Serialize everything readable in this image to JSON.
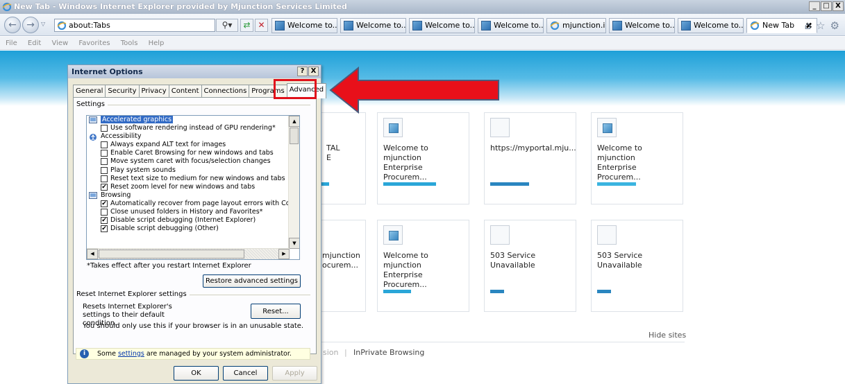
{
  "window": {
    "title": "New Tab - Windows Internet Explorer provided by Mjunction Services Limited",
    "controls": [
      "_",
      "□",
      "X"
    ]
  },
  "nav": {
    "address": "about:Tabs",
    "tabs": [
      {
        "label": "Welcome to..."
      },
      {
        "label": "Welcome to..."
      },
      {
        "label": "Welcome to..."
      },
      {
        "label": "Welcome to..."
      },
      {
        "label": "mjunction.in"
      },
      {
        "label": "Welcome to..."
      },
      {
        "label": "Welcome to..."
      },
      {
        "label": "New Tab"
      }
    ],
    "close_tab": "✖"
  },
  "menu": [
    "File",
    "Edit",
    "View",
    "Favorites",
    "Tools",
    "Help"
  ],
  "newtab": {
    "tiles": [
      {
        "text": "TAL\nE",
        "bar": "#2aa6d8"
      },
      {
        "text": "Welcome to mjunction\nEnterprise Procurem...",
        "bar": "#2aa6d8"
      },
      {
        "text": "https://myportal.mju...",
        "bar": "#2a86c0"
      },
      {
        "text": "Welcome to mjunction\nEnterprise Procurem...",
        "bar": "#3bb4e0"
      },
      {
        "text": "mjunction\nocurem...",
        "bar": ""
      },
      {
        "text": "Welcome to mjunction\nEnterprise Procurem...",
        "bar": "#2aa6d8"
      },
      {
        "text": "503 Service\nUnavailable",
        "bar": "#2a86c0"
      },
      {
        "text": "503 Service\nUnavailable",
        "bar": "#2a86c0"
      }
    ],
    "hide_sites": "Hide sites",
    "reopen_partial": "sion",
    "separator": "|",
    "inprivate": "InPrivate Browsing"
  },
  "dialog": {
    "title": "Internet Options",
    "help_btn": "?",
    "close_btn": "X",
    "tabs": [
      "General",
      "Security",
      "Privacy",
      "Content",
      "Connections",
      "Programs",
      "Advanced"
    ],
    "active_tab": "Advanced",
    "settings_label": "Settings",
    "tree": [
      {
        "type": "cat",
        "label": "Accelerated graphics",
        "icon": "monitor-icon",
        "selected": true
      },
      {
        "type": "opt",
        "label": "Use software rendering instead of GPU rendering*",
        "checked": false
      },
      {
        "type": "cat",
        "label": "Accessibility",
        "icon": "accessibility-icon"
      },
      {
        "type": "opt",
        "label": "Always expand ALT text for images",
        "checked": false
      },
      {
        "type": "opt",
        "label": "Enable Caret Browsing for new windows and tabs",
        "checked": false
      },
      {
        "type": "opt",
        "label": "Move system caret with focus/selection changes",
        "checked": false
      },
      {
        "type": "opt",
        "label": "Play system sounds",
        "checked": false
      },
      {
        "type": "opt",
        "label": "Reset text size to medium for new windows and tabs",
        "checked": false
      },
      {
        "type": "opt",
        "label": "Reset zoom level for new windows and tabs",
        "checked": true
      },
      {
        "type": "cat",
        "label": "Browsing",
        "icon": "monitor-icon"
      },
      {
        "type": "opt",
        "label": "Automatically recover from page layout errors with Compa",
        "checked": true
      },
      {
        "type": "opt",
        "label": "Close unused folders in History and Favorites*",
        "checked": false
      },
      {
        "type": "opt",
        "label": "Disable script debugging (Internet Explorer)",
        "checked": true
      },
      {
        "type": "opt",
        "label": "Disable script debugging (Other)",
        "checked": true
      }
    ],
    "restart_note": "*Takes effect after you restart Internet Explorer",
    "restore_btn": "Restore advanced settings",
    "reset_group": "Reset Internet Explorer settings",
    "reset_desc": "Resets Internet Explorer's settings to their default condition.",
    "reset_btn": "Reset...",
    "unusable_note": "You should only use this if your browser is in an unusable state.",
    "admin_prefix": "Some ",
    "admin_link": "settings",
    "admin_suffix": " are managed by your system administrator.",
    "ok_btn": "OK",
    "cancel_btn": "Cancel",
    "apply_btn": "Apply"
  },
  "colors": {
    "annotation": "#e0101a",
    "selection": "#316ac5"
  }
}
